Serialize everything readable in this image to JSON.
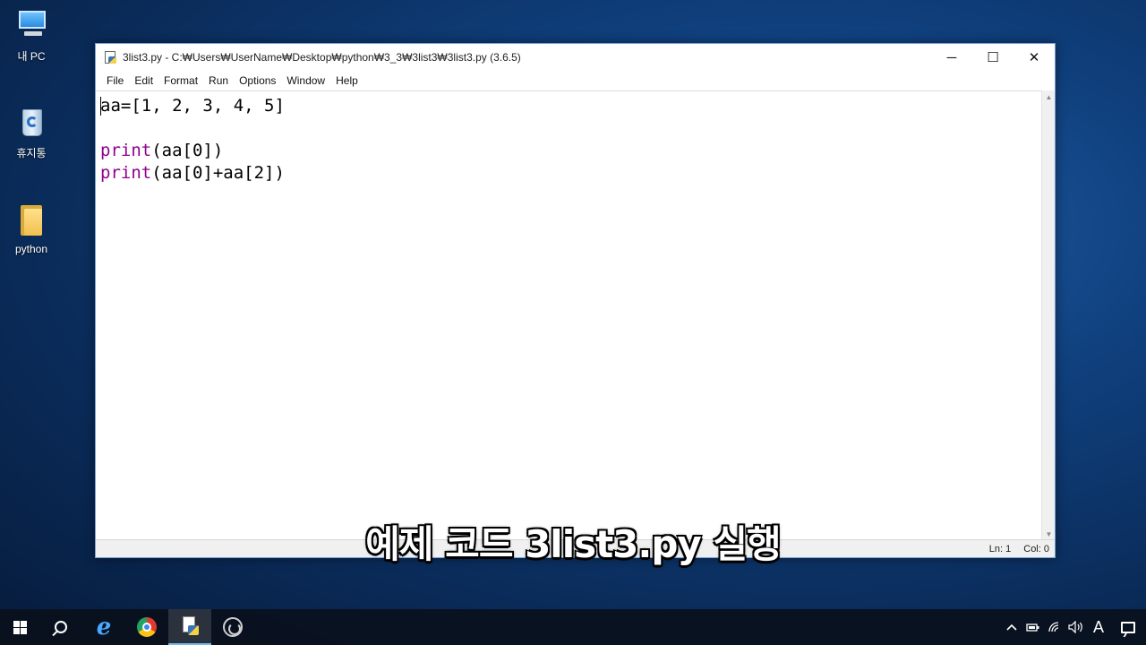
{
  "desktop": {
    "icons": [
      {
        "label": "내 PC",
        "icon": "pc-icon"
      },
      {
        "label": "휴지통",
        "icon": "recycle-bin-icon"
      },
      {
        "label": "python",
        "icon": "folder-icon"
      }
    ]
  },
  "window": {
    "title": "3list3.py - C:₩Users₩UserName₩Desktop₩python₩3_3₩3list3₩3list3.py (3.6.5)",
    "controls": {
      "minimize": "─",
      "maximize": "☐",
      "close": "✕"
    },
    "menu": [
      "File",
      "Edit",
      "Format",
      "Run",
      "Options",
      "Window",
      "Help"
    ],
    "code": {
      "line1": "aa=[1, 2, 3, 4, 5]",
      "line3_kw": "print",
      "line3_rest": "(aa[0])",
      "line4_kw": "print",
      "line4_rest": "(aa[0]+aa[2])"
    },
    "status": {
      "ln": "Ln: 1",
      "col": "Col: 0"
    }
  },
  "caption": "예제 코드 3list3.py 실행",
  "taskbar": {
    "apps": [
      {
        "name": "start-button",
        "icon": "windows-icon"
      },
      {
        "name": "search-button",
        "icon": "search-icon"
      },
      {
        "name": "internet-explorer",
        "icon": "ie-icon"
      },
      {
        "name": "chrome",
        "icon": "chrome-icon"
      },
      {
        "name": "python-idle",
        "icon": "idle-icon",
        "active": true
      },
      {
        "name": "obs",
        "icon": "obs-icon"
      }
    ],
    "tray": {
      "ime": "A"
    }
  },
  "colors": {
    "keyword": "#900090",
    "accent": "#76b9ed"
  }
}
